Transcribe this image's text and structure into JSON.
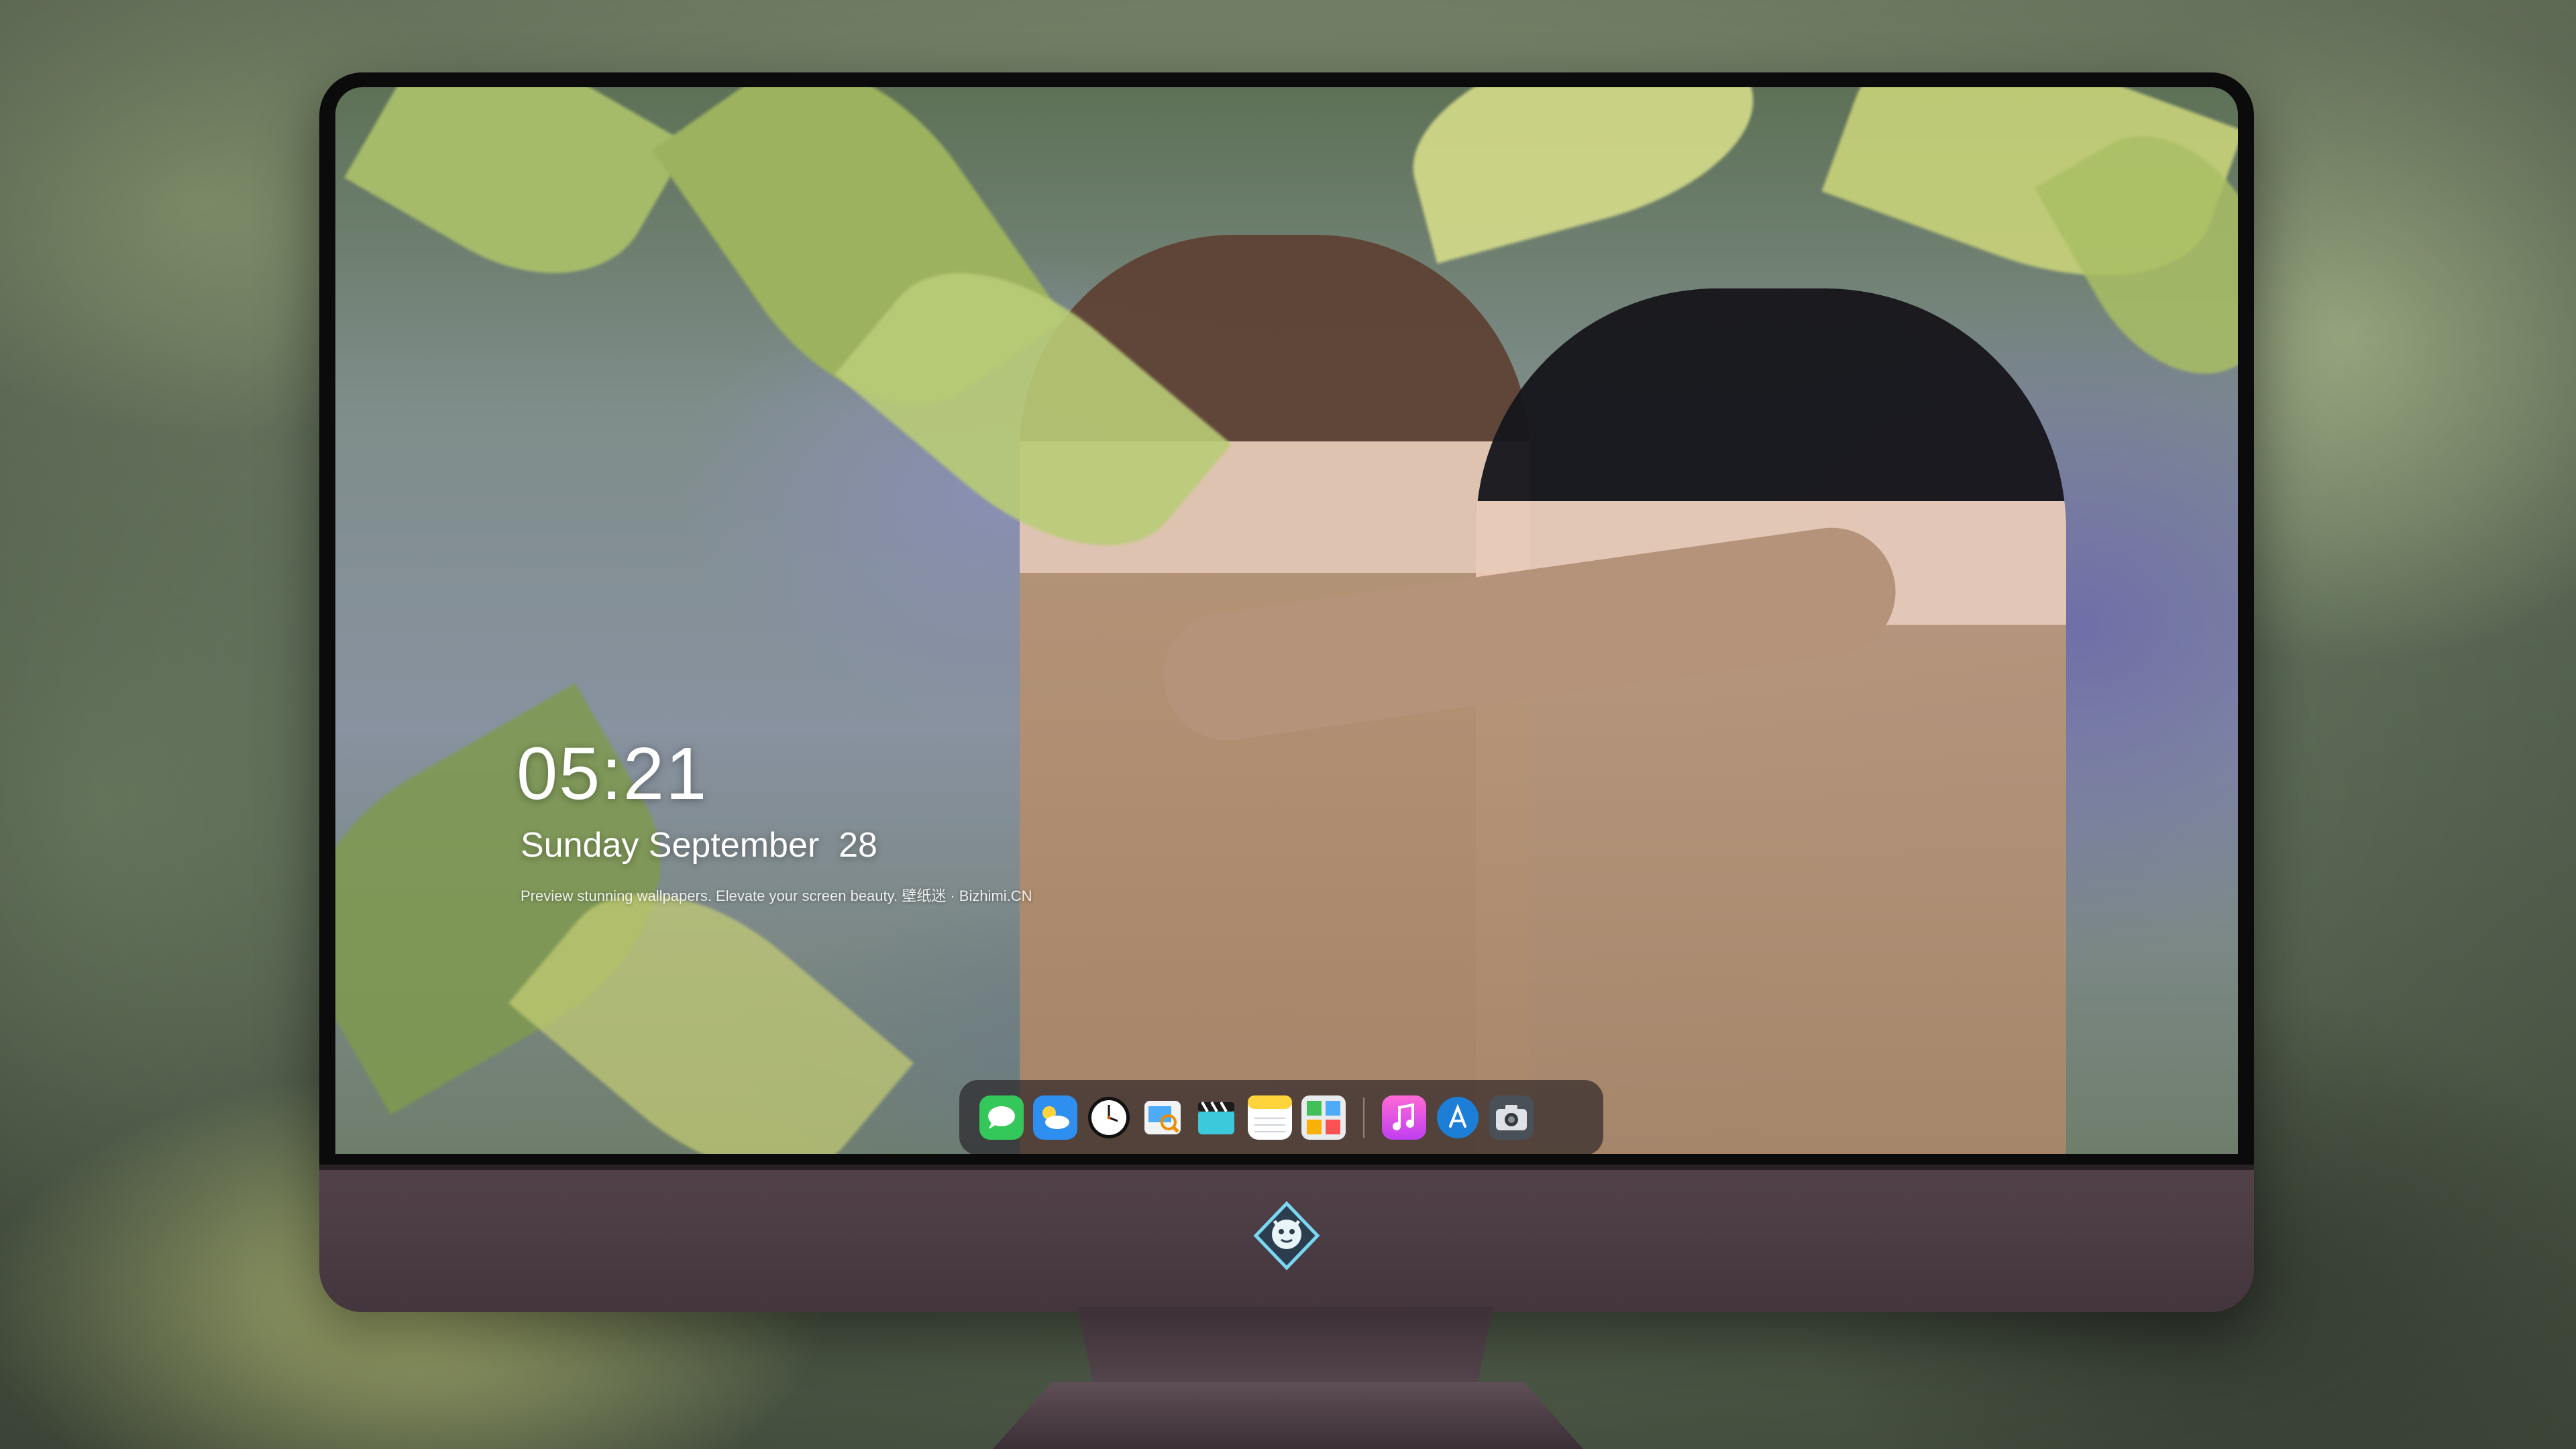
{
  "lockscreen": {
    "time": "05:21",
    "date": "Sunday September  28",
    "tagline": "Preview stunning wallpapers. Elevate your screen beauty. 壁纸迷 · Bizhimi.CN"
  },
  "dock": {
    "apps": [
      {
        "name": "messages",
        "icon": "messages-icon"
      },
      {
        "name": "weather",
        "icon": "weather-icon"
      },
      {
        "name": "clock",
        "icon": "clock-icon"
      },
      {
        "name": "preview",
        "icon": "preview-icon"
      },
      {
        "name": "clips",
        "icon": "clapperboard-icon"
      },
      {
        "name": "notes",
        "icon": "notes-icon"
      },
      {
        "name": "photo-booth",
        "icon": "photo-grid-icon"
      },
      {
        "name": "music",
        "icon": "music-note-icon"
      },
      {
        "name": "app-store",
        "icon": "app-store-icon"
      },
      {
        "name": "camera",
        "icon": "camera-icon"
      }
    ]
  },
  "colors": {
    "bezel": "#0b0b0c",
    "chin": "#4b3c43",
    "dock_bg": "#1e1a1e"
  }
}
